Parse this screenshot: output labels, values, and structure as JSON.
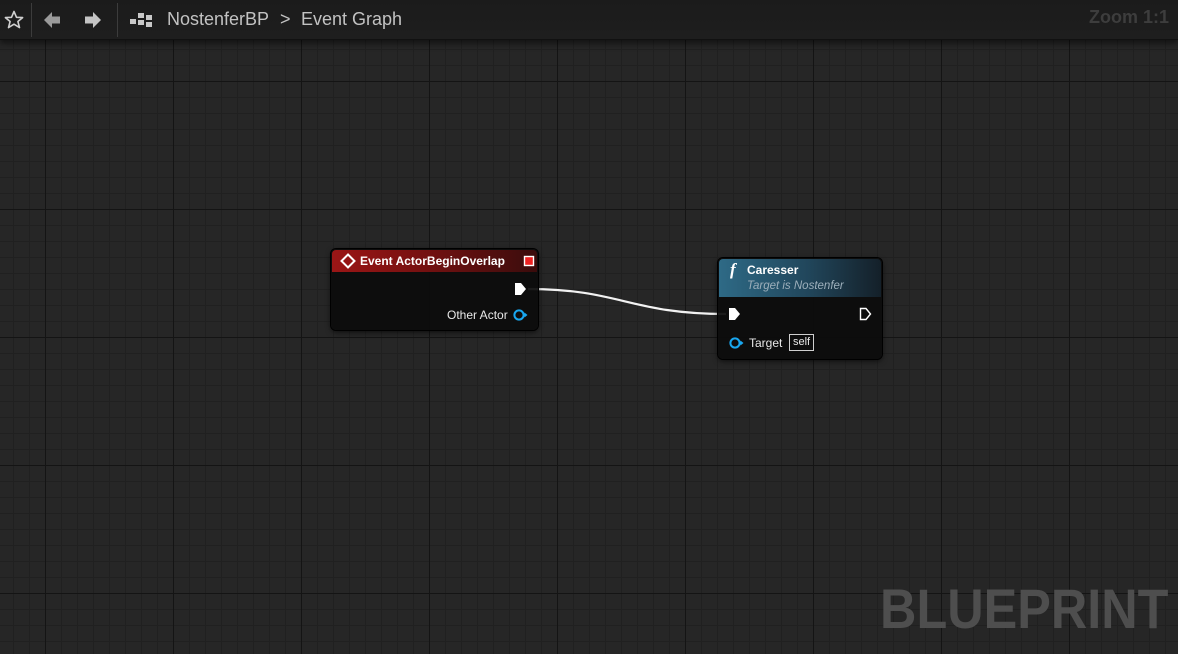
{
  "toolbar": {
    "breadcrumb_root": "NostenferBP",
    "breadcrumb_separator": ">",
    "breadcrumb_current": "Event Graph",
    "zoom_label": "Zoom 1:1",
    "icons": [
      "star-icon",
      "back-arrow-icon",
      "forward-arrow-icon",
      "blueprint-graph-icon"
    ]
  },
  "graph": {
    "watermark": "BLUEPRINT",
    "event_node": {
      "title": "Event ActorBeginOverlap",
      "header_color": "#9b1616",
      "output_pin_label": "Other Actor",
      "icons": [
        "event-diamond-icon",
        "delegate-square-icon",
        "exec-out-pin-icon",
        "object-pin-icon"
      ]
    },
    "function_node": {
      "title": "Caresser",
      "subtitle": "Target is Nostenfer",
      "header_color": "#2e6a86",
      "input_pin_label": "Target",
      "target_default": "self",
      "icons": [
        "function-f-icon",
        "exec-in-pin-icon",
        "exec-out-pin-icon",
        "object-pin-icon"
      ]
    },
    "connection": {
      "from": "Event ActorBeginOverlap.exec",
      "to": "Caresser.exec",
      "color": "#ffffff"
    }
  }
}
